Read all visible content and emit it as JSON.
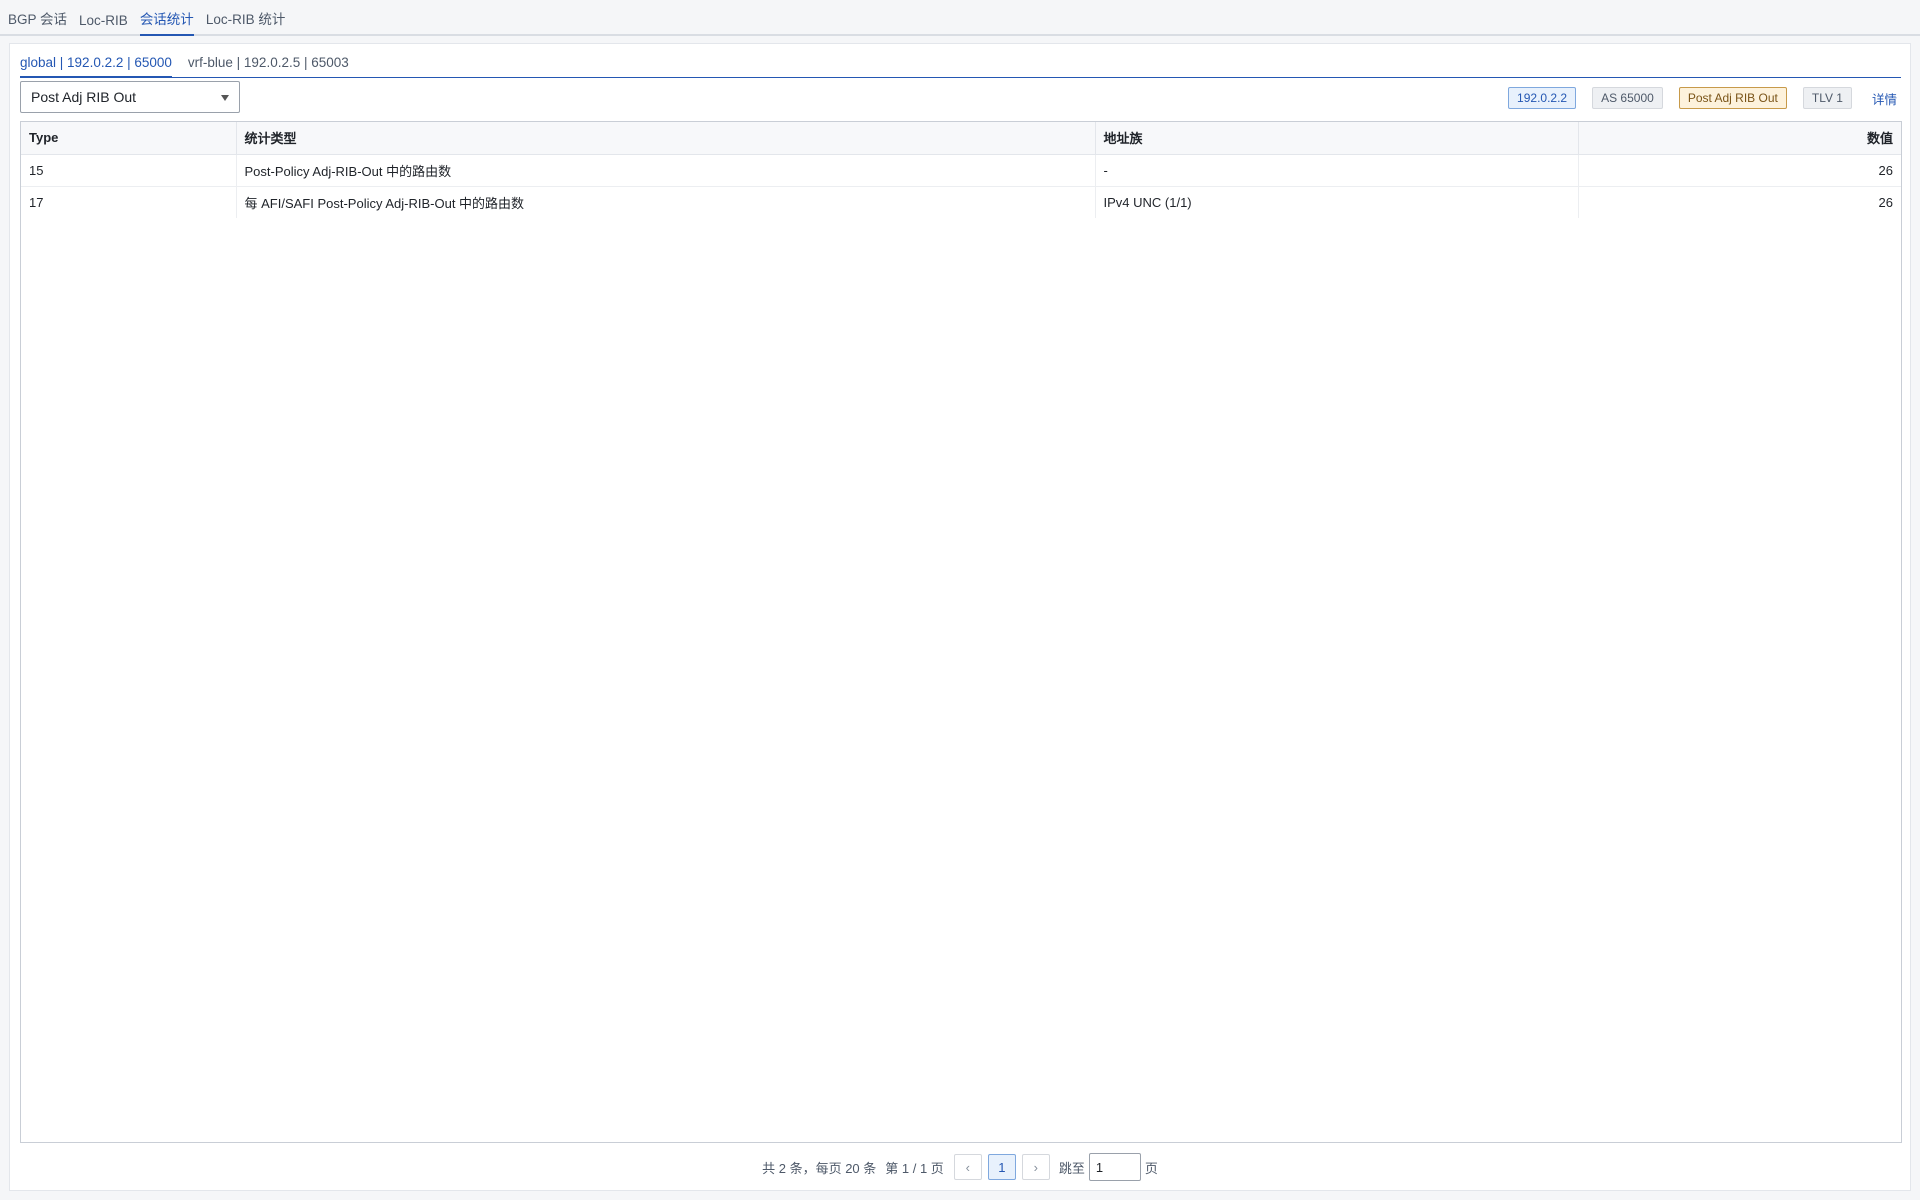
{
  "top_tabs": [
    {
      "label": "BGP 会话",
      "active": false
    },
    {
      "label": "Loc-RIB",
      "active": false
    },
    {
      "label": "会话统计",
      "active": true
    },
    {
      "label": "Loc-RIB 统计",
      "active": false
    }
  ],
  "sub_tabs": [
    {
      "label": "global | 192.0.2.2 | 65000",
      "active": true
    },
    {
      "label": "vrf-blue | 192.0.2.5 | 65003",
      "active": false
    }
  ],
  "toolbar": {
    "select_value": "Post Adj RIB Out",
    "badges": {
      "peer_ip": "192.0.2.2",
      "asn": "AS 65000",
      "rib_type": "Post Adj RIB Out",
      "tlv": "TLV 1"
    },
    "detail_link": "详情"
  },
  "table": {
    "headers": [
      "Type",
      "统计类型",
      "地址族",
      "数值"
    ],
    "rows": [
      [
        "15",
        "Post-Policy Adj-RIB-Out 中的路由数",
        "-",
        "26"
      ],
      [
        "17",
        "每 AFI/SAFI Post-Policy Adj-RIB-Out 中的路由数",
        "IPv4 UNC (1/1)",
        "26"
      ]
    ]
  },
  "pager": {
    "summary": "共 2 条，每页 20 条",
    "page_info": "第 1 / 1 页",
    "prev": "‹",
    "current_page": "1",
    "next": "›",
    "jump_label": "跳至",
    "jump_value": "1",
    "page_suffix": "页"
  }
}
